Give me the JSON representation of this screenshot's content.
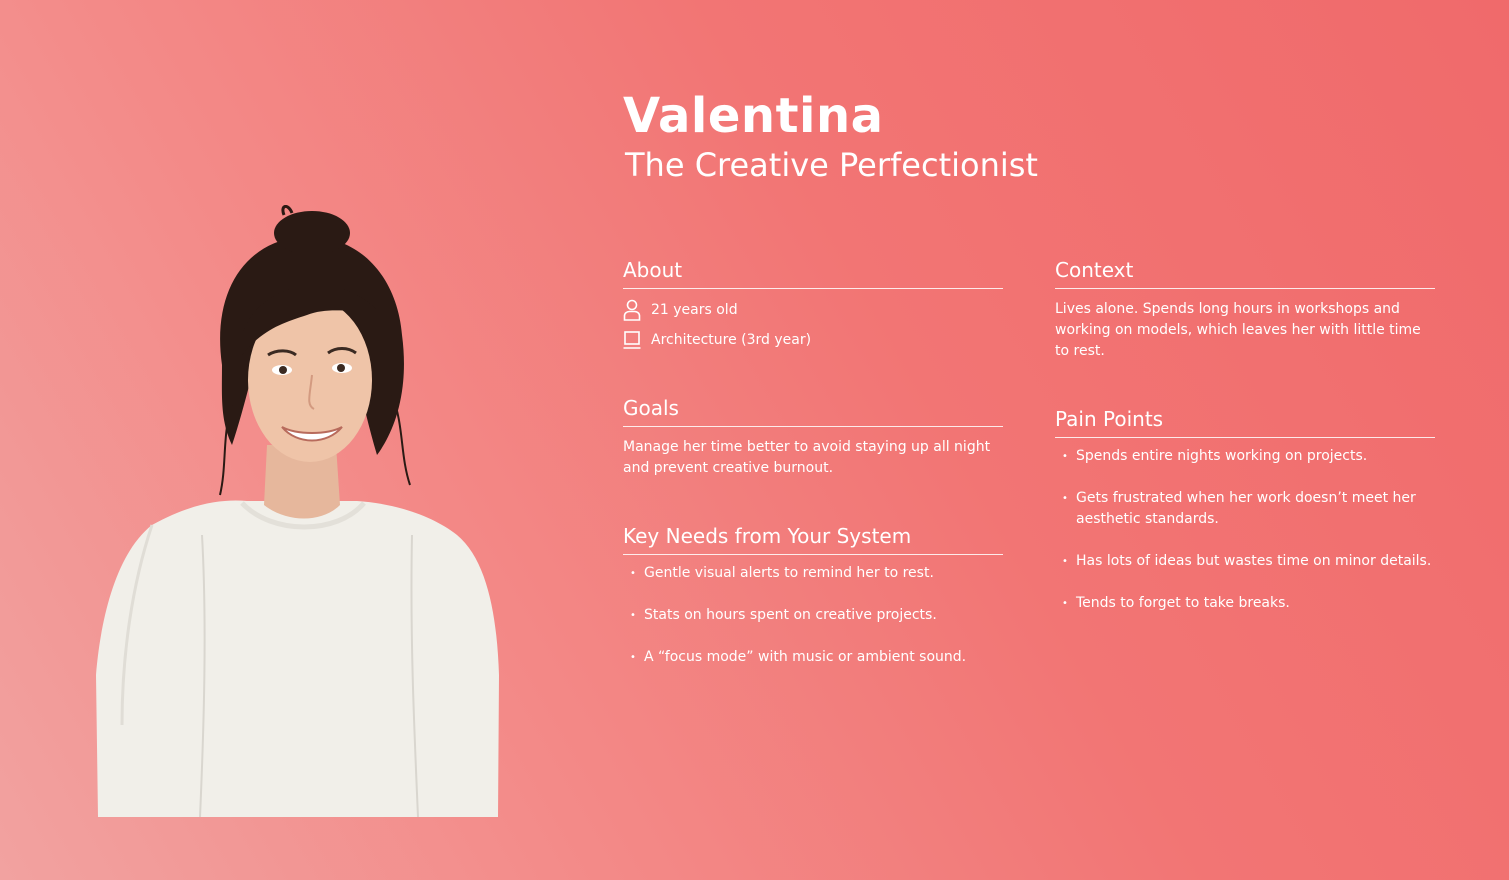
{
  "persona": {
    "name": "Valentina",
    "subtitle": "The Creative Perfectionist"
  },
  "about": {
    "heading": "About",
    "age": "21 years old",
    "age_icon": "person-icon",
    "study": "Architecture (3rd year)",
    "study_icon": "laptop-icon"
  },
  "goals": {
    "heading": "Goals",
    "text": "Manage her time better to avoid staying up all night and prevent creative burnout."
  },
  "needs": {
    "heading": "Key Needs from Your System",
    "items": [
      "Gentle visual alerts to remind her to rest.",
      "Stats on hours spent on creative projects.",
      "A “focus mode” with music or ambient sound."
    ]
  },
  "context": {
    "heading": "Context",
    "text": "Lives alone. Spends long hours in workshops and working on models, which leaves her with little time to rest."
  },
  "pain_points": {
    "heading": "Pain Points",
    "items": [
      "Spends entire nights working on projects.",
      "Gets frustrated when her work doesn’t meet her aesthetic standards.",
      "Has lots of ideas but wastes time on minor details.",
      "Tends to forget to take breaks."
    ]
  },
  "colors": {
    "background_start": "#f2a2a0",
    "background_end": "#f06a6b",
    "text": "#ffffff"
  }
}
